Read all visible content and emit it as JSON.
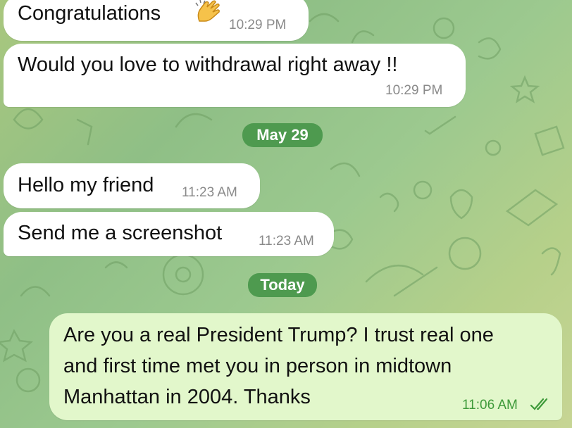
{
  "messages": [
    {
      "id": "m1",
      "direction": "incoming",
      "text": "Congratulations",
      "emoji": "clapping-hands",
      "time": "10:29 PM"
    },
    {
      "id": "m2",
      "direction": "incoming",
      "text": "Would you love to withdrawal right away !!",
      "time": "10:29 PM"
    },
    {
      "id": "m3",
      "direction": "incoming",
      "text": "Hello my friend",
      "time": "11:23 AM"
    },
    {
      "id": "m4",
      "direction": "incoming",
      "text": "Send me a screenshot",
      "time": "11:23 AM"
    },
    {
      "id": "m5",
      "direction": "outgoing",
      "lines": [
        "Are you a real President Trump? I trust real one",
        "and first time met you in person in midtown",
        "Manhattan in 2004. Thanks"
      ],
      "time": "11:06 AM",
      "status": "read"
    }
  ],
  "date_separators": {
    "first": "May 29",
    "second": "Today"
  },
  "colors": {
    "incoming_bubble": "#ffffff",
    "outgoing_bubble": "#e2f7cb",
    "date_pill": "#4e9a4f",
    "read_check": "#3e9a3a"
  },
  "icons": {
    "emoji": "clapping-hands-emoji",
    "read_status": "double-check-icon"
  }
}
